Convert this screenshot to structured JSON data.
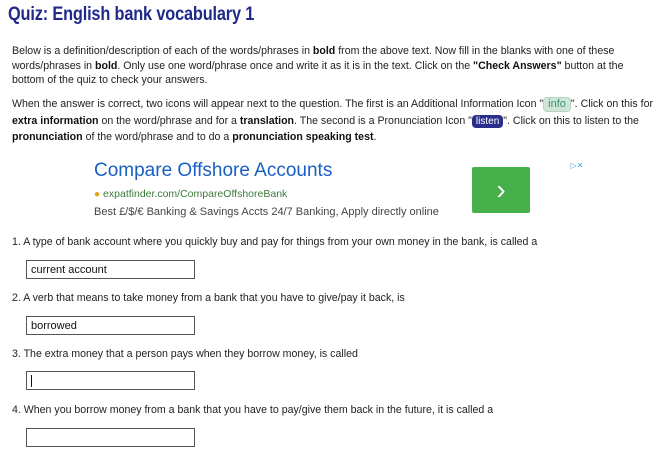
{
  "page": {
    "title": "Quiz: English bank vocabulary 1"
  },
  "intro": {
    "p1": [
      {
        "t": "Below is a definition/description of each of the words/phrases in ",
        "b": false
      },
      {
        "t": "bold",
        "b": true
      },
      {
        "t": " from the above text. Now fill in the blanks with one of these words/phrases in ",
        "b": false
      },
      {
        "t": "bold",
        "b": true
      },
      {
        "t": ". Only use one word/phrase once and write it as it is in the text. Click on the ",
        "b": false
      },
      {
        "t": "\"Check Answers\"",
        "b": true
      },
      {
        "t": " button at the bottom of the quiz to check your answers.",
        "b": false
      }
    ],
    "p2_a": "When the answer is correct, two icons will appear next to the question. The first is an Additional Information Icon \"",
    "info_badge": "info",
    "p2_b": "\". Click on this for ",
    "p2_b_bold": "extra information",
    "p2_c": " on the word/phrase and for a ",
    "p2_c_bold": "translation",
    "p2_d": ". The second is a Pronunciation Icon \"",
    "listen_badge": "listen",
    "p2_e": "\". Click on this to listen to the ",
    "p2_e_bold": "pronunciation",
    "p2_f": " of the word/phrase and to do a ",
    "p2_f_bold": "pronunciation speaking test",
    "p2_g": "."
  },
  "ad": {
    "title": "Compare Offshore Accounts",
    "url": "expatfinder.com/CompareOffshoreBank",
    "description": "Best £/$/€ Banking & Savings Accts 24/7 Banking, Apply directly online",
    "arrow": "›",
    "choices": "▷✕"
  },
  "questions": [
    {
      "text": "1. A type of bank account where you quickly buy and pay for things from your own money in the bank, is called a",
      "value": "current account"
    },
    {
      "text": "2. A verb that means to take money from a bank that you have to give/pay it back, is",
      "value": "borrowed"
    },
    {
      "text": "3. The extra money that a person pays when they borrow money, is called",
      "value": ""
    },
    {
      "text": "4. When you borrow money from a bank that you have to pay/give them back in the future, it is called a",
      "value": ""
    }
  ]
}
